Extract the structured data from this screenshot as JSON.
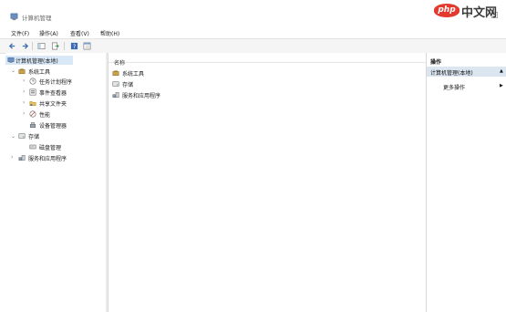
{
  "window": {
    "title": "计算机管理",
    "icon": "computer-management-icon"
  },
  "watermark": {
    "logo": "php",
    "text": "中文网"
  },
  "menu": [
    "文件(F)",
    "操作(A)",
    "查看(V)",
    "帮助(H)"
  ],
  "toolbar": {
    "icons": [
      "back-arrow-icon",
      "forward-arrow-icon",
      "console-tree-icon",
      "export-icon",
      "help-icon",
      "properties-icon"
    ]
  },
  "tree": {
    "root": "计算机管理(本地)",
    "system_tools": "系统工具",
    "task_scheduler": "任务计划程序",
    "event_viewer": "事件查看器",
    "shared_folders": "共享文件夹",
    "performance": "性能",
    "device_manager": "设备管理器",
    "storage": "存储",
    "disk_management": "磁盘管理",
    "services_apps": "服务和应用程序"
  },
  "center": {
    "column_name": "名称",
    "items": [
      "系统工具",
      "存储",
      "服务和应用程序"
    ]
  },
  "actions": {
    "header": "操作",
    "selected": "计算机管理(本地)",
    "more": "更多操作",
    "selected_arrow": "▲",
    "more_arrow": "▶"
  },
  "colors": {
    "selection": "#d9e8f6",
    "action_band": "#dce6f1",
    "watermark_red": "#e33a2f"
  }
}
